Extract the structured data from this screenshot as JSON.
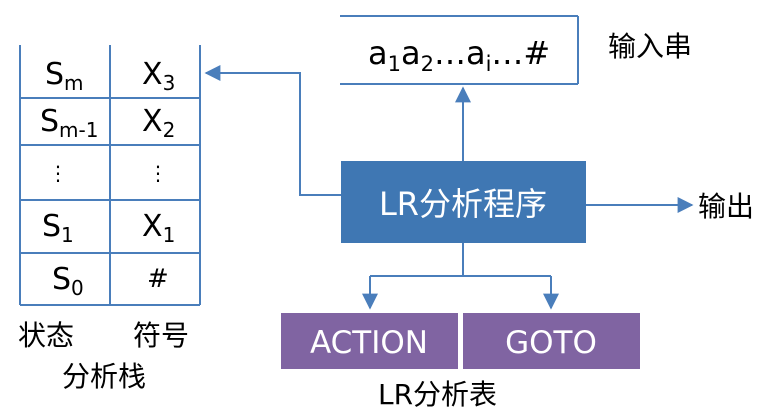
{
  "colors": {
    "line": "#4a7ebb",
    "program_box": "#3f77b3",
    "table_box": "#8064a2",
    "text": "#000000",
    "box_text": "#ffffff"
  },
  "stack": {
    "rows": [
      {
        "state": "S",
        "state_sub": "m",
        "symbol": "X",
        "symbol_sub": "3"
      },
      {
        "state": "S",
        "state_sub": "m-1",
        "symbol": "X",
        "symbol_sub": "2"
      },
      {
        "state": "⋮",
        "state_sub": "",
        "symbol": "⋮",
        "symbol_sub": ""
      },
      {
        "state": "S",
        "state_sub": "1",
        "symbol": "X",
        "symbol_sub": "1"
      },
      {
        "state": "S",
        "state_sub": "0",
        "symbol": "#",
        "symbol_sub": ""
      }
    ],
    "state_label": "状态",
    "symbol_label": "符号",
    "title": "分析栈"
  },
  "input": {
    "parts": [
      {
        "base": "a",
        "sub": "1"
      },
      {
        "base": "a",
        "sub": "2"
      },
      {
        "base": "…a",
        "sub": "i"
      },
      {
        "base": "…#",
        "sub": ""
      }
    ],
    "label": "输入串"
  },
  "program": {
    "label": "LR分析程序"
  },
  "output": {
    "label": "输出"
  },
  "table": {
    "action": "ACTION",
    "goto": "GOTO",
    "title": "LR分析表"
  }
}
